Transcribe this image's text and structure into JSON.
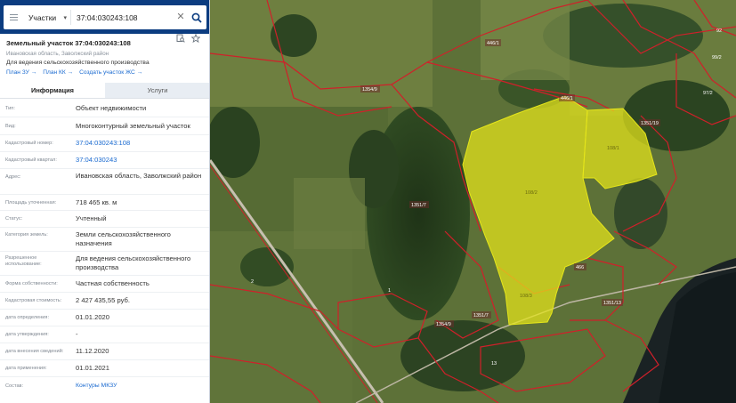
{
  "search": {
    "type_label": "Участки",
    "query": "37:04:030243:108"
  },
  "parcel": {
    "title": "Земельный участок 37:04:030243:108",
    "address_short": "Ивановская область, Заволжский район",
    "purpose": "Для ведения сельскохозяйственного производства"
  },
  "links": {
    "plan_zu": "План ЗУ →",
    "plan_kk": "План КК →",
    "create_zhs": "Создать участок ЖС →"
  },
  "tabs": {
    "info": "Информация",
    "services": "Услуги"
  },
  "info_rows": [
    {
      "label": "Тип:",
      "value": "Объект недвижимости"
    },
    {
      "label": "Вид:",
      "value": "Многоконтурный земельный участок"
    },
    {
      "label": "Кадастровый номер:",
      "value": "37:04:030243:108"
    },
    {
      "label": "Кадастровый квартал:",
      "value": "37:04:030243"
    },
    {
      "label": "Адрес:",
      "value": "Ивановская область, Заволжский район"
    },
    {
      "label": "Площадь уточненная:",
      "value": "718 465 кв. м"
    },
    {
      "label": "Статус:",
      "value": "Учтенный"
    },
    {
      "label": "Категория земель:",
      "value": "Земли сельскохозяйственного назначения"
    },
    {
      "label": "Разрешенное использование:",
      "value": "Для ведения сельскохозяйственного производства"
    },
    {
      "label": "Форма собственности:",
      "value": "Частная собственность"
    },
    {
      "label": "Кадастровая стоимость:",
      "value": "2 427 435,55 руб."
    },
    {
      "label": "дата определения:",
      "value": "01.01.2020"
    },
    {
      "label": "дата утверждения:",
      "value": "-"
    },
    {
      "label": "дата внесения сведений:",
      "value": "11.12.2020"
    },
    {
      "label": "дата применения:",
      "value": "01.01.2021"
    },
    {
      "label": "Состав:",
      "value": "Контуры МКЗУ"
    }
  ],
  "map_labels": {
    "l1": "446/1",
    "l2": "1354/9",
    "l3": "108/2",
    "l4": "108/1",
    "l5": "108/3",
    "l6": "1351/7",
    "l7": "1351/19",
    "l8": "1354/9",
    "l9": "466",
    "l10": "1",
    "l11": "2",
    "l12": "13",
    "l13": "1351/7",
    "l14": "446/1",
    "l15": "99/2",
    "l16": "97/2",
    "l17": "92",
    "l18": "1351/13"
  },
  "colors": {
    "header_bg": "#0b3c80",
    "link": "#1a6ad0",
    "parcel_fill": "#e6e61a",
    "boundary": "#d0202a"
  }
}
